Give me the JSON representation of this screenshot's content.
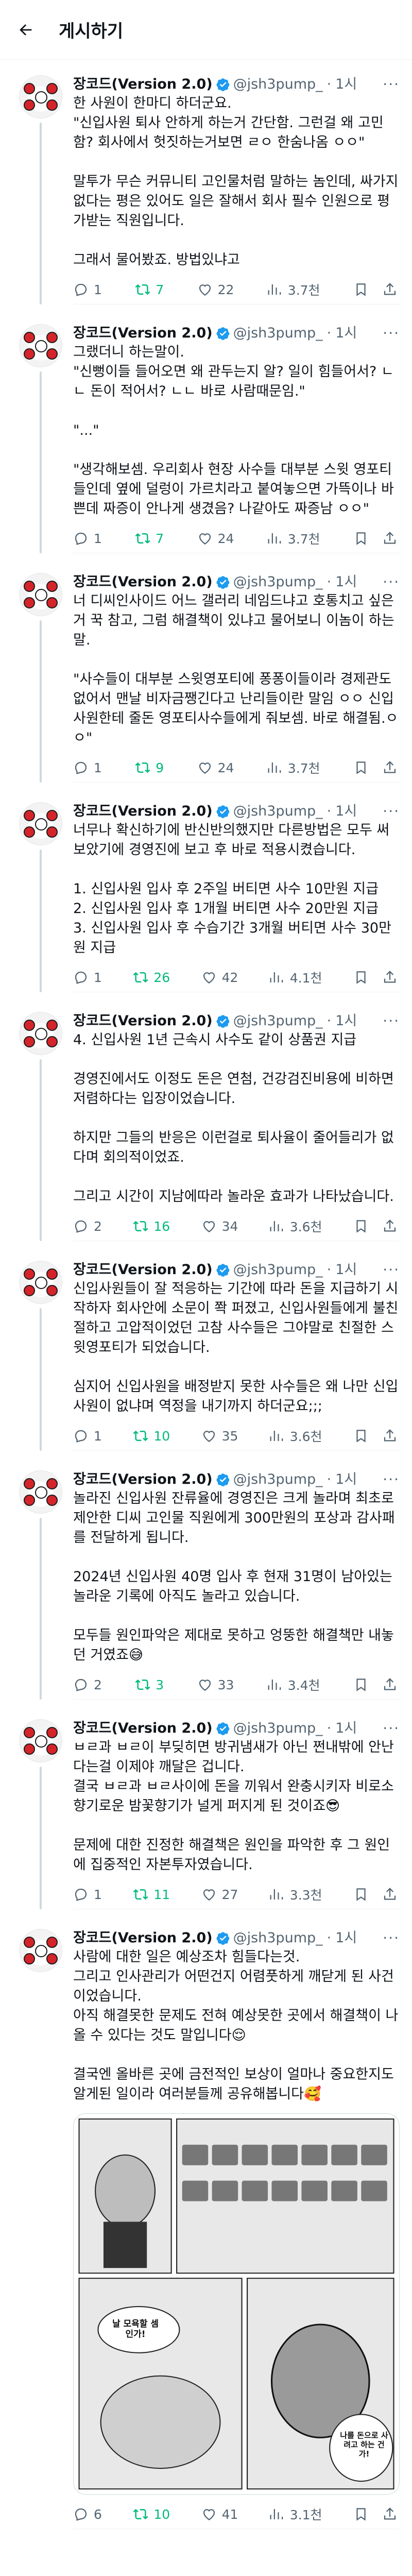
{
  "topbar": {
    "title": "게시하기"
  },
  "author": {
    "name": "장코드(Version 2.0)",
    "handle": "@jsh3pump_",
    "dot": "·",
    "more": "···"
  },
  "posts": [
    {
      "time": "1시",
      "lines": [
        "한 사원이 한마디 하더군요.",
        "\"신입사원 퇴사 안하게 하는거 간단함. 그런걸 왜 고민함? 회사에서 헛짓하는거보면 ㄹㅇ 한숨나옴 ㅇㅇ\"",
        "",
        "말투가 무슨 커뮤니티 고인물처럼 말하는 놈인데, 싸가지없다는 평은 있어도 일은 잘해서 회사 필수 인원으로 평가받는 직원입니다.",
        "",
        "그래서 물어봤죠. 방법있냐고"
      ],
      "replies": "1",
      "retweets": "7",
      "likes": "22",
      "views": "3.7천"
    },
    {
      "time": "1시",
      "lines": [
        "그랬더니 하는말이.",
        "\"신뻥이들 들어오면 왜 관두는지 알? 일이 힘들어서? ㄴㄴ 돈이 적어서? ㄴㄴ 바로 사람때문임.\"",
        "",
        "\"...\"",
        "",
        "\"생각해보셈. 우리회사 현장 사수들 대부분 스윗 영포티들인데 옆에 덜렁이 가르치라고 붙여놓으면 가뜩이나 바쁜데 짜증이 안나게 생겼음? 나같아도 짜증남 ㅇㅇ\""
      ],
      "replies": "1",
      "retweets": "7",
      "likes": "24",
      "views": "3.7천"
    },
    {
      "time": "1시",
      "lines": [
        "너 디씨인사이드 어느 갤러리 네임드냐고 호통치고 싶은거 꾹 참고, 그럼 해결책이 있냐고 물어보니 이놈이 하는말.",
        "",
        "\"사수들이 대부분 스윗영포티에 퐁퐁이들이라 경제관도 없어서 맨날 비자금쨍긴다고 난리들이란 말임 ㅇㅇ 신입사원한테 줄돈 영포티사수들에게 줘보셈. 바로 해결됨.ㅇㅇ\""
      ],
      "replies": "1",
      "retweets": "9",
      "likes": "24",
      "views": "3.7천"
    },
    {
      "time": "1시",
      "lines": [
        "너무나 확신하기에 반신반의했지만 다른방법은 모두 써보았기에 경영진에 보고 후 바로 적용시켰습니다.",
        "",
        "1. 신입사원 입사 후 2주일 버티면 사수 10만원 지급",
        "2. 신입사원 입사 후 1개월 버티면 사수 20만원 지급",
        "3. 신입사원 입사 후 수습기간 3개월 버티면 사수 30만원 지급"
      ],
      "replies": "1",
      "retweets": "26",
      "likes": "42",
      "views": "4.1천"
    },
    {
      "time": "1시",
      "lines": [
        "4. 신입사원 1년 근속시 사수도 같이 상품권 지급",
        "",
        "경영진에서도 이정도 돈은 연첨, 건강검진비용에 비하면 저렴하다는 입장이었습니다.",
        "",
        "하지만 그들의 반응은 이런걸로 퇴사율이 줄어들리가 없다며 회의적이었죠.",
        "",
        "그리고 시간이 지남에따라 놀라운 효과가 나타났습니다."
      ],
      "replies": "2",
      "retweets": "16",
      "likes": "34",
      "views": "3.6천"
    },
    {
      "time": "1시",
      "lines": [
        "신입사원들이 잘 적응하는 기간에 따라 돈을 지급하기 시작하자 회사안에 소문이 쫙 퍼졌고, 신입사원들에게 불친절하고 고압적이었던 고참 사수들은 그야말로 친절한 스윗영포티가 되었습니다.",
        "",
        "심지어 신입사원을 배정받지 못한 사수들은 왜 나만 신입사원이 없냐며 역정을 내기까지 하더군요;;;"
      ],
      "replies": "1",
      "retweets": "10",
      "likes": "35",
      "views": "3.6천"
    },
    {
      "time": "1시",
      "lines": [
        "놀라진 신입사원 잔류율에 경영진은 크게 놀라며 최초로 제안한 디씨 고인물 직원에게 300만원의 포상과 감사패를 전달하게 됩니다.",
        "",
        "2024년 신입사원 40명 입사 후 현재 31명이 남아있는 놀라운 기록에 아직도 놀라고 있습니다.",
        "",
        "모두들 원인파악은 제대로 못하고 엉뚱한 해결책만 내놓던 거였죠😅"
      ],
      "replies": "2",
      "retweets": "3",
      "likes": "33",
      "views": "3.4천"
    },
    {
      "time": "1시",
      "lines": [
        "ㅂㄹ과 ㅂㄹ이 부딪히면 방귀냄새가 아닌 쩐내밖에 안난다는걸 이제야 깨달은 겁니다.",
        "결국 ㅂㄹ과 ㅂㄹ사이에 돈을 끼워서 완충시키자 비로소 향기로운 밤꽃향기가 널게 퍼지게 된 것이죠😎",
        "",
        "문제에 대한 진정한 해결책은 원인을 파악한 후 그 원인에 집중적인 자본투자였습니다."
      ],
      "replies": "1",
      "retweets": "11",
      "likes": "27",
      "views": "3.3천"
    },
    {
      "time": "1시",
      "lines": [
        "사람에 대한 일은 예상조차 힘들다는것.",
        "그리고 인사관리가 어떤건지 어렴풋하게 깨닫게 된 사건이었습니다.",
        "아직 해결못한 문제도 전혀 예상못한 곳에서 해결책이 나올 수 있다는 것도 말입니다😌",
        "",
        "결국엔 올바른 곳에 금전적인 보상이 얼마나 중요한지도 알게된 일이라 여러분들께 공유해봅니다🥰"
      ],
      "media": {
        "bubble_left": "날 모욕할 셈인가!",
        "bubble_right": "나를 돈으로 사려고 하는 건가!"
      },
      "replies": "6",
      "retweets": "10",
      "likes": "41",
      "views": "3.1천"
    }
  ],
  "icons": {
    "back": "arrow-left-icon",
    "verified": "verified-badge-icon",
    "reply": "reply-icon",
    "retweet": "retweet-icon",
    "like": "heart-icon",
    "views": "bar-chart-icon",
    "bookmark": "bookmark-icon",
    "share": "share-icon"
  },
  "colors": {
    "verified": "#1d9bf0",
    "retweet_active": "#00ba7c",
    "muted": "#536471",
    "thread_line": "#cfd9de"
  }
}
